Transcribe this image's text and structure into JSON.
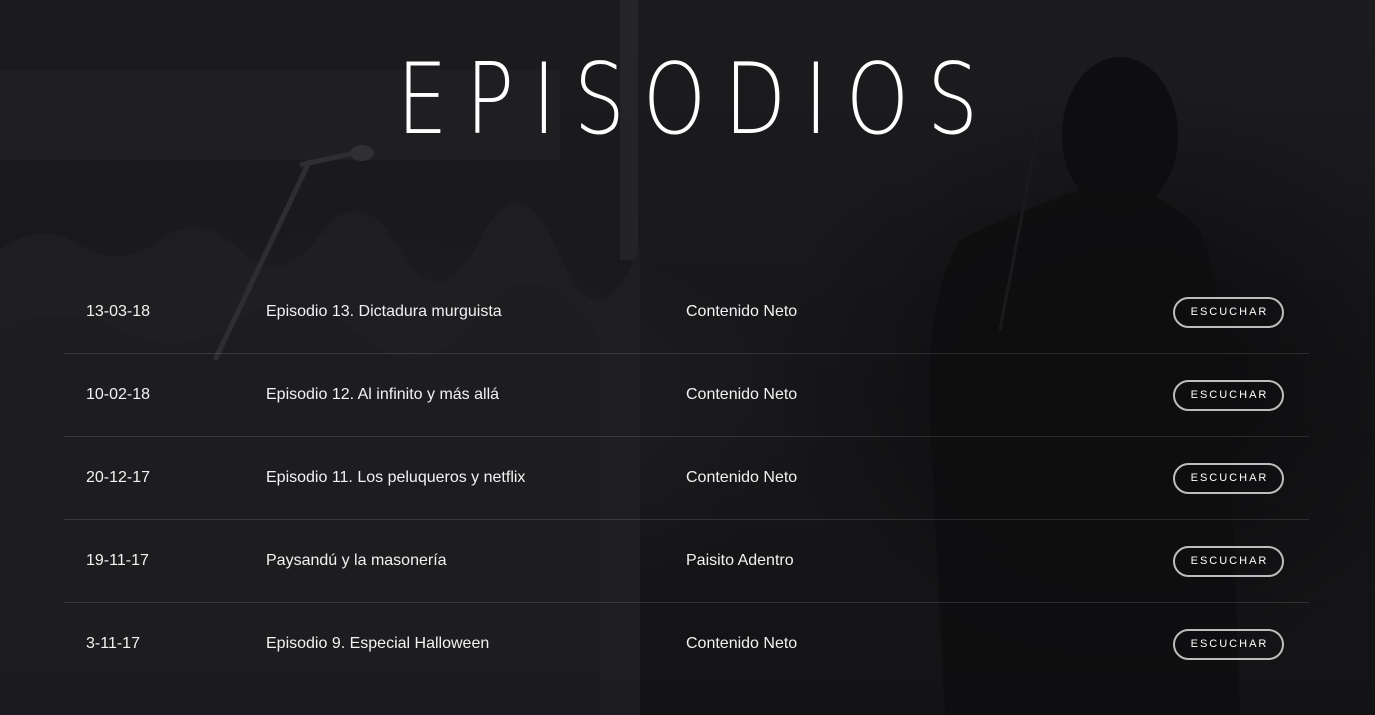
{
  "section": {
    "title": "EPISODIOS"
  },
  "episodes": [
    {
      "date": "13-03-18",
      "title": "Episodio 13. Dictadura murguista",
      "program": "Contenido Neto",
      "button": "ESCUCHAR"
    },
    {
      "date": "10-02-18",
      "title": "Episodio 12. Al infinito y más allá",
      "program": "Contenido Neto",
      "button": "ESCUCHAR"
    },
    {
      "date": "20-12-17",
      "title": "Episodio 11. Los peluqueros y netflix",
      "program": "Contenido Neto",
      "button": "ESCUCHAR"
    },
    {
      "date": "19-11-17",
      "title": "Paysandú y la masonería",
      "program": "Paisito Adentro",
      "button": "ESCUCHAR"
    },
    {
      "date": "3-11-17",
      "title": "Episodio 9. Especial Halloween",
      "program": "Contenido Neto",
      "button": "ESCUCHAR"
    }
  ],
  "colors": {
    "background": "#18181b",
    "text": "#f2f2f2",
    "button_border": "#bdbdbd"
  }
}
